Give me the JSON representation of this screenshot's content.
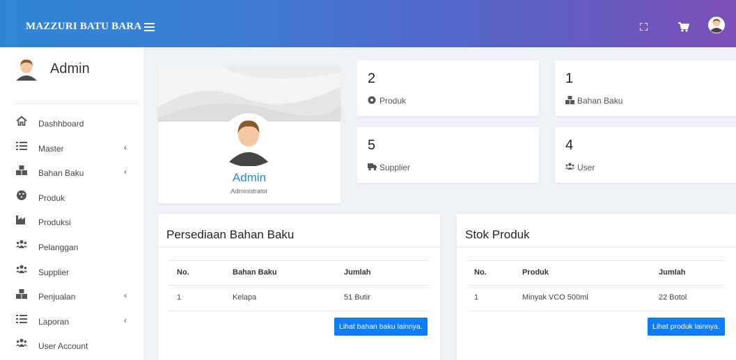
{
  "brand": "MAZZURI BATU BARA",
  "colors": {
    "accent": "#2f86d8",
    "button": "#0f7bff",
    "gradient_start": "#2f86d8",
    "gradient_end": "#7b4fb8"
  },
  "topbar": {
    "icons": [
      "menu-icon",
      "fullscreen-icon",
      "cart-icon",
      "user-avatar-icon"
    ]
  },
  "sidebar": {
    "user": "Admin",
    "items": [
      {
        "label": "Dashhboard",
        "icon": "home-icon",
        "chevron": ""
      },
      {
        "label": "Master",
        "icon": "list-icon",
        "chevron": "‹"
      },
      {
        "label": "Bahan Baku",
        "icon": "boxes-icon",
        "chevron": "‹"
      },
      {
        "label": "Produk",
        "icon": "product-icon",
        "chevron": ""
      },
      {
        "label": "Produksi",
        "icon": "industry-icon",
        "chevron": ""
      },
      {
        "label": "Pelanggan",
        "icon": "users-icon",
        "chevron": ""
      },
      {
        "label": "Supplier",
        "icon": "users-icon",
        "chevron": ""
      },
      {
        "label": "Penjualan",
        "icon": "boxes-icon",
        "chevron": "‹"
      },
      {
        "label": "Laporan",
        "icon": "list-icon",
        "chevron": "‹"
      },
      {
        "label": "User Account",
        "icon": "users-icon",
        "chevron": ""
      }
    ]
  },
  "profile": {
    "name": "Admin",
    "role": "Administrator"
  },
  "stats": [
    {
      "value": "2",
      "label": "Produk",
      "icon": "circle-icon"
    },
    {
      "value": "1",
      "label": "Bahan Baku",
      "icon": "boxes-icon"
    },
    {
      "value": "5",
      "label": "Supplier",
      "icon": "truck-icon"
    },
    {
      "value": "4",
      "label": "User",
      "icon": "users-icon"
    }
  ],
  "bahan_baku": {
    "title": "Persediaan Bahan Baku",
    "headers": [
      "No.",
      "Bahan Baku",
      "Jumlah"
    ],
    "rows": [
      [
        "1",
        "Kelapa",
        "51 Butir"
      ]
    ],
    "button": "Lihat bahan baku lainnya."
  },
  "stok_produk": {
    "title": "Stok Produk",
    "headers": [
      "No.",
      "Produk",
      "Jumlah"
    ],
    "rows": [
      [
        "1",
        "Minyak VCO 500ml",
        "22 Botol"
      ]
    ],
    "button": "Lihat produk lainnya."
  }
}
